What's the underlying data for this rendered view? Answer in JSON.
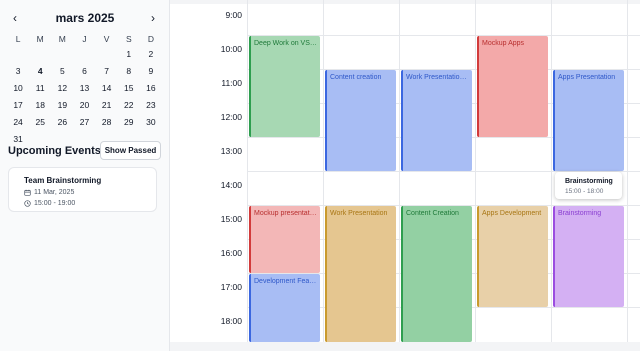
{
  "sidebar": {
    "month_title": "mars 2025",
    "prev_icon": "‹",
    "next_icon": "›",
    "days_of_week": [
      "L",
      "M",
      "M",
      "J",
      "V",
      "S",
      "D"
    ],
    "weeks": [
      [
        "",
        "",
        "",
        "",
        "",
        "1",
        "2"
      ],
      [
        "3",
        "4",
        "5",
        "6",
        "7",
        "8",
        "9"
      ],
      [
        "10",
        "11",
        "12",
        "13",
        "14",
        "15",
        "16"
      ],
      [
        "17",
        "18",
        "19",
        "20",
        "21",
        "22",
        "23"
      ],
      [
        "24",
        "25",
        "26",
        "27",
        "28",
        "29",
        "30"
      ],
      [
        "31",
        "",
        "",
        "",
        "",
        "",
        ""
      ]
    ],
    "upcoming_title": "Upcoming Events",
    "show_passed_label": "Show Passed",
    "event_card": {
      "title": "Team Brainstorming",
      "date": "11 Mar, 2025",
      "time": "15:00 - 19:00"
    }
  },
  "calendar": {
    "time_labels": [
      "9:00",
      "10:00",
      "11:00",
      "12:00",
      "13:00",
      "14:00",
      "15:00",
      "16:00",
      "17:00",
      "18:00"
    ],
    "events": [
      {
        "title": "Deep Work on VSCode",
        "color": "#2e9e4f",
        "bg": "#a7d8b3",
        "tc": "#1f7a3a"
      },
      {
        "title": "Content creation",
        "color": "#3b67e0",
        "bg": "#a8bdf4",
        "tc": "#2f58c9"
      },
      {
        "title": "Work Presentation Review",
        "color": "#3b67e0",
        "bg": "#a8bdf4",
        "tc": "#2f58c9"
      },
      {
        "title": "Mockup Apps",
        "color": "#d23b3b",
        "bg": "#f3a9a9",
        "tc": "#b82f2f"
      },
      {
        "title": "Apps Presentation",
        "color": "#3b67e0",
        "bg": "#a8bdf4",
        "tc": "#2f58c9"
      },
      {
        "title": "Mockup presentation",
        "color": "#d23b3b",
        "bg": "#f3b7b7",
        "tc": "#b82f2f"
      },
      {
        "title": "Development Feature",
        "color": "#3b67e0",
        "bg": "#a8bdf4",
        "tc": "#2f58c9"
      },
      {
        "title": "Work Presentation",
        "color": "#c99a2e",
        "bg": "#e5c690",
        "tc": "#a87614"
      },
      {
        "title": "Content Creation",
        "color": "#2e9e4f",
        "bg": "#93d0a3",
        "tc": "#1f7a3a"
      },
      {
        "title": "Apps Development",
        "color": "#c99a2e",
        "bg": "#e8d0a8",
        "tc": "#a87614"
      },
      {
        "title": "Brainstorming",
        "color": "#9b4de0",
        "bg": "#d4b0f3",
        "tc": "#8a3fd1"
      }
    ],
    "tooltip": {
      "title": "Brainstorming",
      "time": "15:00 - 18:00"
    }
  }
}
